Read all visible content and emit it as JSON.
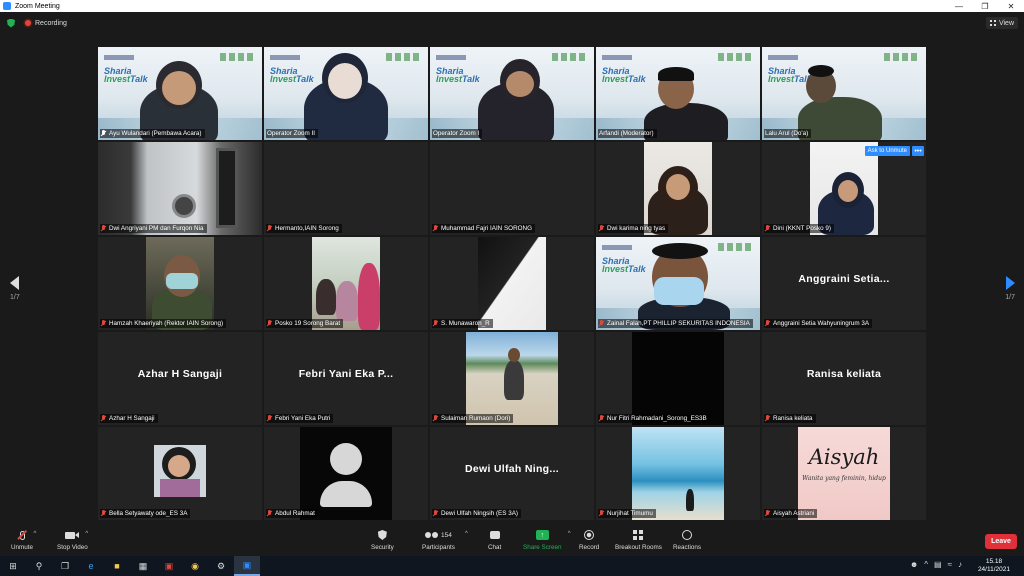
{
  "window": {
    "title": "Zoom Meeting",
    "controls": [
      "—",
      "❐",
      "✕"
    ]
  },
  "topbar": {
    "recording_label": "Recording",
    "view_label": "View"
  },
  "gallery": {
    "page_left": "1/7",
    "page_right": "1/7",
    "ask_to_unmute": "Ask to Unmute",
    "more": "•••",
    "tiles": [
      {
        "label": "Ayu Wulandari (Pembawa Acara)",
        "kind": "banner",
        "mic": "white",
        "active": true
      },
      {
        "label": "Operator Zoom II",
        "kind": "banner"
      },
      {
        "label": "Operator Zoom I",
        "kind": "banner"
      },
      {
        "label": "Arfandi (Moderator)",
        "kind": "banner"
      },
      {
        "label": "Lalu Arul (Do'a)",
        "kind": "banner"
      },
      {
        "label": "Dwi Angriyani PM dan Furqon Nia",
        "kind": "video",
        "mic": "red"
      },
      {
        "label": "Hermanto,IAIN Sorong",
        "kind": "empty",
        "mic": "red"
      },
      {
        "label": "Muhammad Fajri IAIN SORONG",
        "kind": "empty",
        "mic": "red"
      },
      {
        "label": "Dwi karima ning tyas",
        "kind": "video",
        "mic": "red"
      },
      {
        "label": "Dini (KKNT Posko 9)",
        "kind": "video",
        "mic": "red",
        "ask": true
      },
      {
        "label": "Hamzah Khaeriyah (Rektor IAIN Sorong)",
        "kind": "video",
        "mic": "red"
      },
      {
        "label": "Posko 19 Sorong Barat",
        "kind": "video",
        "mic": "red"
      },
      {
        "label": "S. Munawaroh_R",
        "kind": "video",
        "mic": "red"
      },
      {
        "label": "Zainal Falah,PT PHILLIP SEKURITAS INDONESIA",
        "kind": "banner",
        "mic": "red"
      },
      {
        "label": "Anggraini Setia Wahyuningrum 3A",
        "kind": "name",
        "center": "Anggraini  Setia...",
        "mic": "red"
      },
      {
        "label": "Azhar H Sangaji",
        "kind": "name",
        "center": "Azhar H Sangaji",
        "mic": "red"
      },
      {
        "label": "Febri Yani Eka Putri",
        "kind": "name",
        "center": "Febri Yani Eka P...",
        "mic": "red"
      },
      {
        "label": "Sulaiman Rumaon (Dori)",
        "kind": "video",
        "mic": "red"
      },
      {
        "label": "Nur Fitri Rahmadani_Sorong_ES3B",
        "kind": "video",
        "mic": "red"
      },
      {
        "label": "Ranisa keliata",
        "kind": "name",
        "center": "Ranisa keliata",
        "mic": "red"
      },
      {
        "label": "Bella Setyawaty ode_ES 3A",
        "kind": "video",
        "mic": "red"
      },
      {
        "label": "Abdul Rahmat",
        "kind": "avatar",
        "mic": "red"
      },
      {
        "label": "Dewi Ulfah Ningsih (ES 3A)",
        "kind": "name",
        "center": "Dewi Ulfah Ning...",
        "mic": "red"
      },
      {
        "label": "Nurjihat Timumu",
        "kind": "video",
        "mic": "red"
      },
      {
        "label": "Aisyah Astriani",
        "kind": "aisyah",
        "mic": "red",
        "img_title": "Aisyah",
        "img_sub": "Wanita yang feminin, hidup"
      }
    ]
  },
  "toolbar": {
    "unmute": "Unmute",
    "stop_video": "Stop Video",
    "security": "Security",
    "participants": "Participants",
    "participants_count": "154",
    "chat": "Chat",
    "share_screen": "Share Screen",
    "record": "Record",
    "breakout_rooms": "Breakout Rooms",
    "reactions": "Reactions",
    "leave": "Leave"
  },
  "taskbar": {
    "time": "15.18",
    "date": "24/11/2021"
  },
  "colors": {
    "accent": "#2d8cff",
    "leave": "#e0313b",
    "active_border": "#c8e233",
    "muted": "#e0463a"
  }
}
